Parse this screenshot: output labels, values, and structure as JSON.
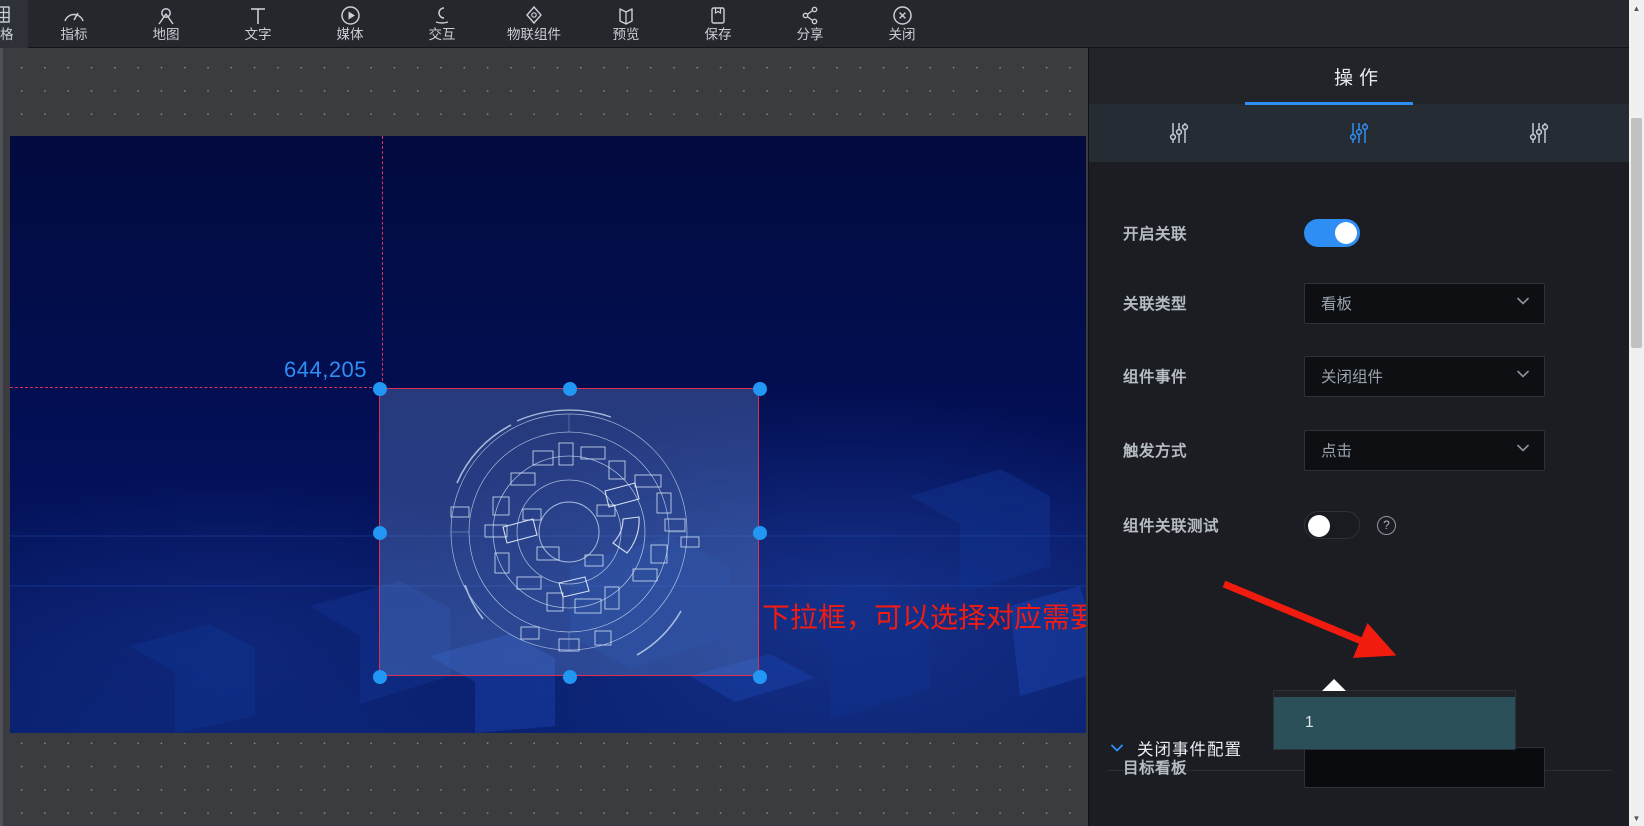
{
  "toolbar": {
    "items": [
      {
        "label": "表格",
        "icon": "table-icon"
      },
      {
        "label": "指标",
        "icon": "gauge-icon"
      },
      {
        "label": "地图",
        "icon": "map-pin-icon"
      },
      {
        "label": "文字",
        "icon": "text-icon"
      },
      {
        "label": "媒体",
        "icon": "media-play-icon"
      },
      {
        "label": "交互",
        "icon": "interaction-icon"
      },
      {
        "label": "物联组件",
        "icon": "iot-component-icon"
      },
      {
        "label": "预览",
        "icon": "preview-icon"
      },
      {
        "label": "保存",
        "icon": "save-icon"
      },
      {
        "label": "分享",
        "icon": "share-icon"
      },
      {
        "label": "关闭",
        "icon": "close-circle-icon"
      }
    ]
  },
  "canvas": {
    "coordinate_label": "644,205",
    "annotation": "下拉框，可以选择对应需要关闭的事件"
  },
  "panel": {
    "title": "操作",
    "tabs": [
      {
        "name": "tab-style",
        "icon": "sliders-icon",
        "active": false
      },
      {
        "name": "tab-action",
        "icon": "sliders-icon",
        "active": true
      },
      {
        "name": "tab-data",
        "icon": "sliders-icon",
        "active": false
      }
    ],
    "fields": {
      "enable_link_label": "开启关联",
      "enable_link_value": "on",
      "link_type_label": "关联类型",
      "link_type_value": "看板",
      "component_event_label": "组件事件",
      "component_event_value": "关闭组件",
      "trigger_mode_label": "触发方式",
      "trigger_mode_value": "点击",
      "link_test_label": "组件关联测试",
      "link_test_value": "off",
      "help_glyph": "?"
    },
    "section": {
      "title": "关闭事件配置",
      "target_board_label": "目标看板",
      "target_board_value": "",
      "options": [
        "1"
      ],
      "selected_option": "1"
    }
  },
  "colors": {
    "accent": "#2f8ef4",
    "annotation_red": "#f21b10",
    "guide_red": "#e0315c",
    "board_bg": "#020a43",
    "panel_bg": "#1b1d22",
    "option_highlight": "#2c5059"
  }
}
